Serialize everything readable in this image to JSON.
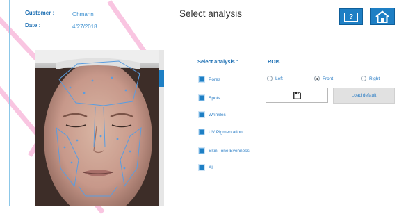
{
  "header": {
    "customer_label": "Customer :",
    "customer_value": "Ohmann",
    "date_label": "Date :",
    "date_value": "4/27/2018",
    "title": "Select analysis",
    "help_label": "?"
  },
  "analysis": {
    "section_label": "Select analysis :",
    "items": [
      {
        "label": "Pores",
        "checked": true
      },
      {
        "label": "Spots",
        "checked": true
      },
      {
        "label": "Wrinkles",
        "checked": true
      },
      {
        "label": "UV Pigmentation",
        "checked": true
      },
      {
        "label": "Skin Tone Evenness",
        "checked": true
      },
      {
        "label": "All",
        "checked": true
      }
    ]
  },
  "rois": {
    "section_label": "ROIs",
    "options": [
      {
        "label": "Left",
        "selected": false
      },
      {
        "label": "Front",
        "selected": true
      },
      {
        "label": "Right",
        "selected": false
      }
    ],
    "load_default_label": "Load default"
  },
  "colors": {
    "accent": "#1e7fc4",
    "label_blue": "#1d6fb3",
    "text_blue": "#2e7fc6"
  },
  "icons": {
    "help": "question-mark-icon",
    "home": "home-icon",
    "save": "floppy-disk-icon"
  }
}
